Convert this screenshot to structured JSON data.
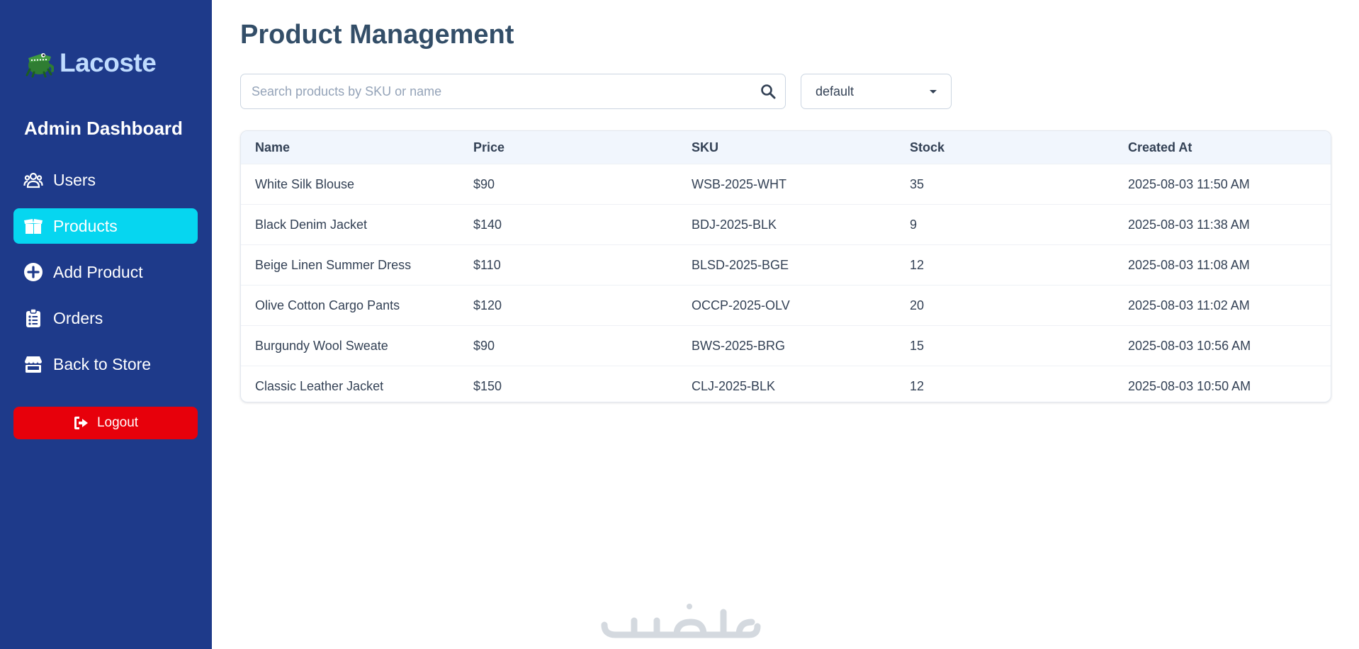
{
  "sidebar": {
    "brand": "Lacoste",
    "heading": "Admin Dashboard",
    "items": [
      {
        "label": "Users",
        "icon": "users-icon",
        "active": false
      },
      {
        "label": "Products",
        "icon": "box-icon",
        "active": true
      },
      {
        "label": "Add Product",
        "icon": "plus-circle-icon",
        "active": false
      },
      {
        "label": "Orders",
        "icon": "clipboard-list-icon",
        "active": false
      },
      {
        "label": "Back to Store",
        "icon": "store-icon",
        "active": false
      }
    ],
    "logout_label": "Logout"
  },
  "main": {
    "title": "Product Management",
    "search": {
      "placeholder": "Search products by SKU or name",
      "value": ""
    },
    "sort_select": {
      "selected": "default"
    },
    "table": {
      "headers": [
        "Name",
        "Price",
        "SKU",
        "Stock",
        "Created At"
      ],
      "rows": [
        [
          "White Silk Blouse",
          "$90",
          "WSB-2025-WHT",
          "35",
          "2025-08-03 11:50 AM"
        ],
        [
          "Black Denim Jacket",
          "$140",
          "BDJ-2025-BLK",
          "9",
          "2025-08-03 11:38 AM"
        ],
        [
          "Beige Linen Summer Dress",
          "$110",
          "BLSD-2025-BGE",
          "12",
          "2025-08-03 11:08 AM"
        ],
        [
          "Olive Cotton Cargo Pants",
          "$120",
          "OCCP-2025-OLV",
          "20",
          "2025-08-03 11:02 AM"
        ],
        [
          "Burgundy Wool Sweate",
          "$90",
          "BWS-2025-BRG",
          "15",
          "2025-08-03 10:56 AM"
        ],
        [
          "Classic Leather Jacket",
          "$150",
          "CLJ-2025-BLK",
          "12",
          "2025-08-03 10:50 AM"
        ]
      ]
    }
  },
  "watermark": "خمسات",
  "colors": {
    "sidebar_bg": "#1e3a8a",
    "active_item": "#06d6f0",
    "logout_bg": "#e7000b",
    "title": "#334e68",
    "table_header_bg": "#f1f6fd"
  }
}
